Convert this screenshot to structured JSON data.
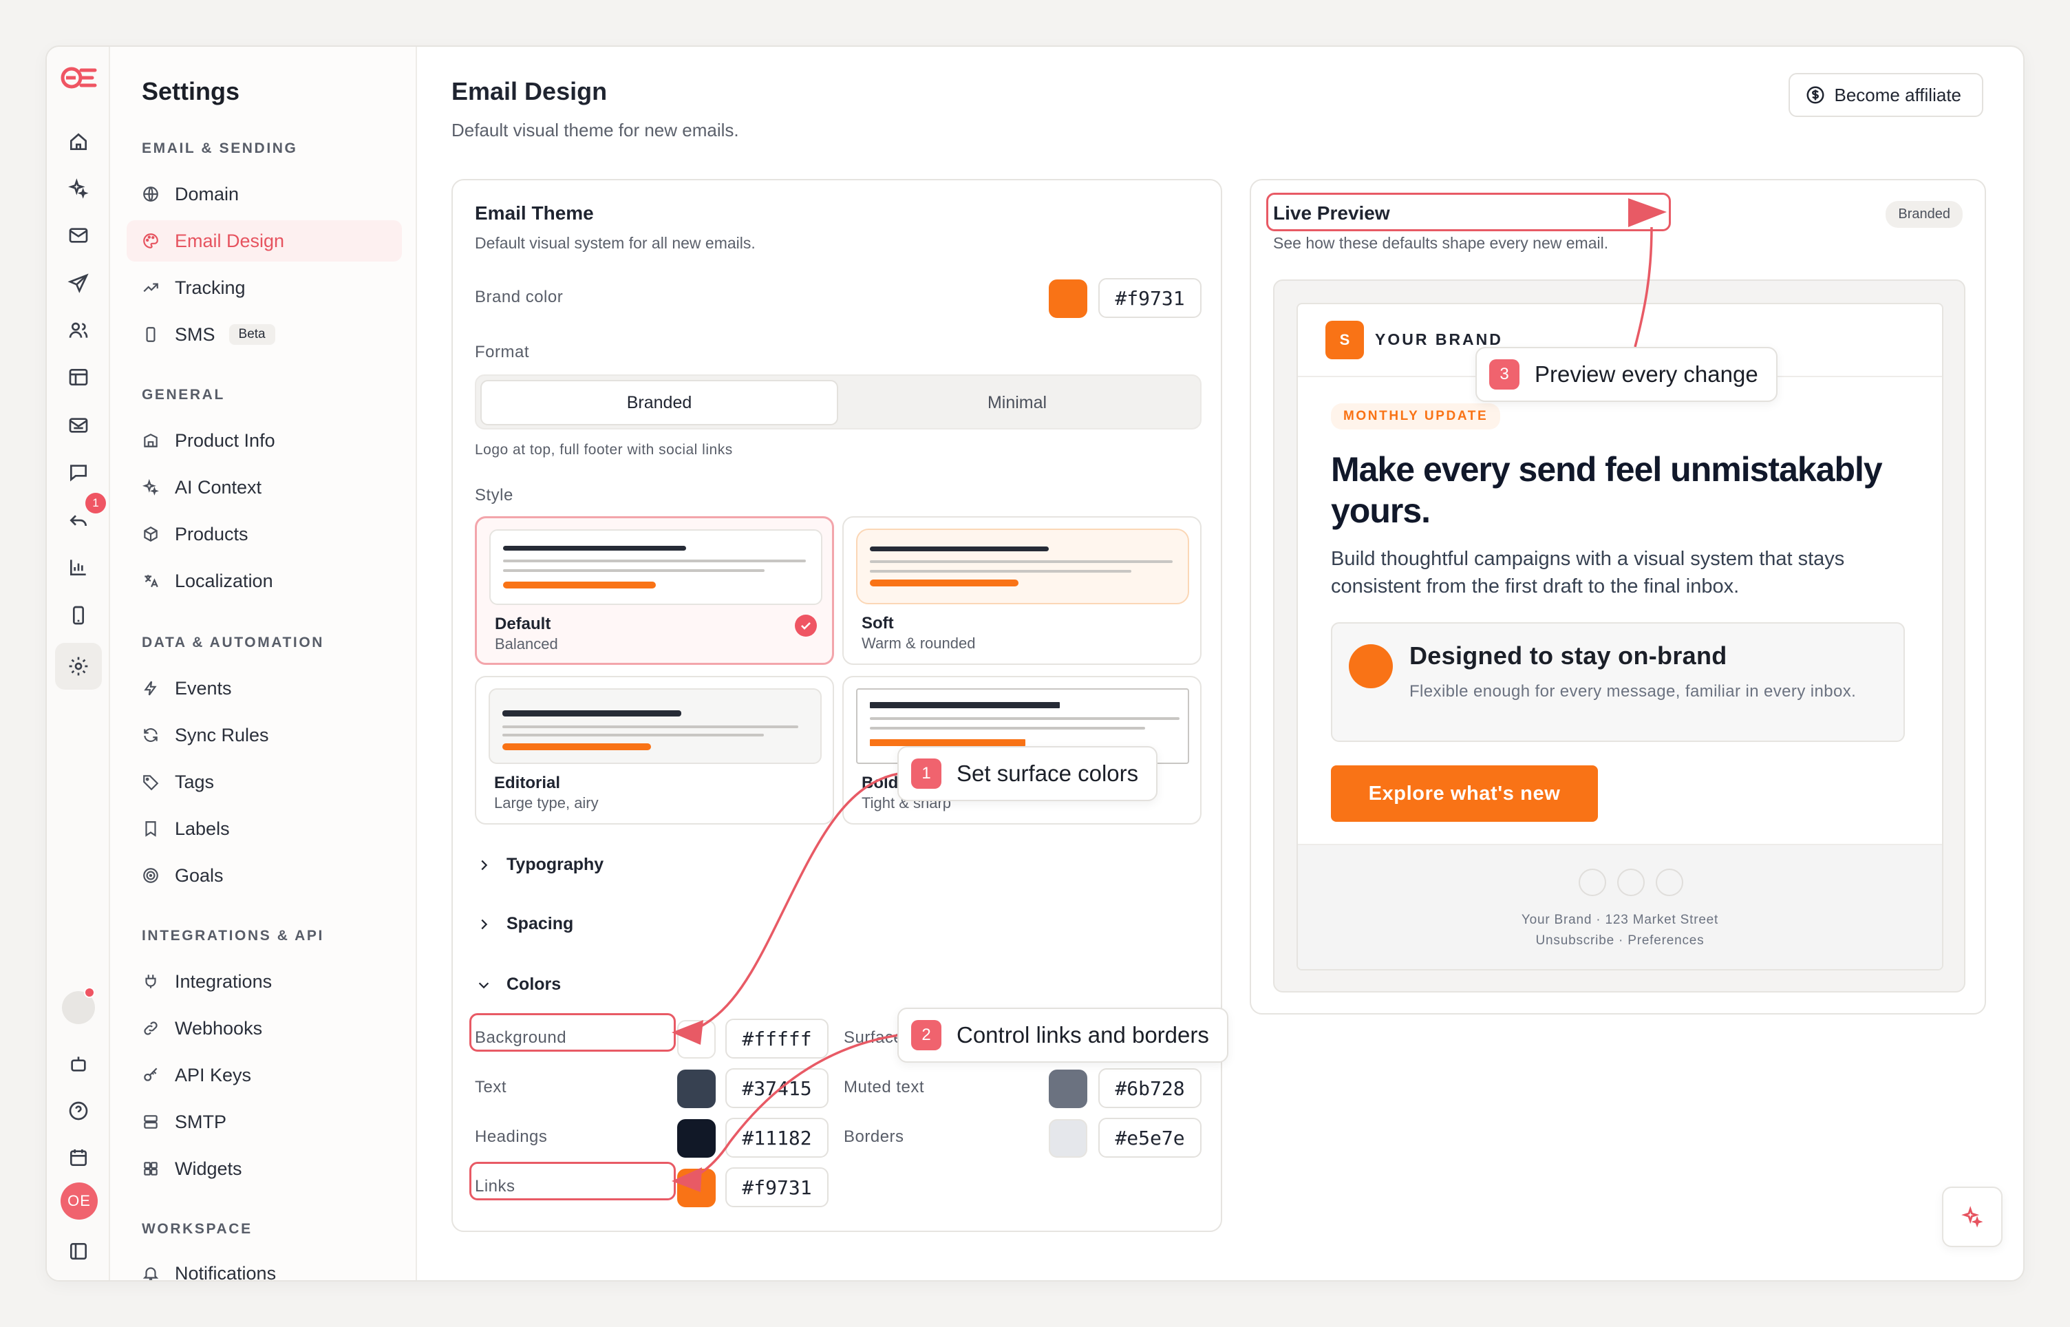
{
  "sidebar": {
    "title": "Settings",
    "notification_count": "1",
    "user_initials": "OE",
    "sections": [
      {
        "title": "EMAIL & SENDING"
      },
      {
        "title": "GENERAL"
      },
      {
        "title": "DATA & AUTOMATION"
      },
      {
        "title": "INTEGRATIONS & API"
      },
      {
        "title": "WORKSPACE"
      }
    ],
    "items": {
      "domain": "Domain",
      "email_design": "Email Design",
      "tracking": "Tracking",
      "sms": "SMS",
      "sms_badge": "Beta",
      "product_info": "Product Info",
      "ai_context": "AI Context",
      "products": "Products",
      "localization": "Localization",
      "events": "Events",
      "sync_rules": "Sync Rules",
      "tags": "Tags",
      "labels": "Labels",
      "goals": "Goals",
      "integrations": "Integrations",
      "webhooks": "Webhooks",
      "api_keys": "API Keys",
      "smtp": "SMTP",
      "widgets": "Widgets",
      "notifications": "Notifications"
    }
  },
  "header": {
    "title": "Email Design",
    "subtitle": "Default visual theme for new emails.",
    "affiliate_label": "Become affiliate"
  },
  "theme": {
    "title": "Email Theme",
    "subtitle": "Default visual system for all new emails.",
    "brand_color_label": "Brand color",
    "brand_color": "#f9731",
    "format_label": "Format",
    "format_options": [
      "Branded",
      "Minimal"
    ],
    "format_hint": "Logo at top, full footer with social links",
    "style_label": "Style",
    "styles": [
      {
        "name": "Default",
        "desc": "Balanced"
      },
      {
        "name": "Soft",
        "desc": "Warm & rounded"
      },
      {
        "name": "Editorial",
        "desc": "Large type, airy"
      },
      {
        "name": "Bold",
        "desc": "Tight & sharp"
      }
    ],
    "sections": {
      "typography": "Typography",
      "spacing": "Spacing",
      "colors": "Colors"
    },
    "colors": {
      "background": {
        "label": "Background",
        "value": "#fffff"
      },
      "surface": {
        "label": "Surface",
        "value": ""
      },
      "text": {
        "label": "Text",
        "value": "#37415"
      },
      "muted": {
        "label": "Muted text",
        "value": "#6b728"
      },
      "headings": {
        "label": "Headings",
        "value": "#11182"
      },
      "borders": {
        "label": "Borders",
        "value": "#e5e7e"
      },
      "links": {
        "label": "Links",
        "value": "#f9731"
      }
    }
  },
  "preview": {
    "title": "Live Preview",
    "subtitle": "See how these defaults shape every new email.",
    "badge": "Branded",
    "email": {
      "logo_letter": "S",
      "brand": "YOUR BRAND",
      "tag": "MONTHLY UPDATE",
      "headline": "Make every send feel unmistakably yours.",
      "body": "Build thoughtful campaigns with a visual system that stays consistent from the first draft to the final inbox.",
      "box_title": "Designed to stay on-brand",
      "box_body": "Flexible enough for every message, familiar in every inbox.",
      "cta": "Explore what's new",
      "footer_address": "Your Brand · 123 Market Street",
      "footer_links": "Unsubscribe · Preferences"
    }
  },
  "callouts": [
    {
      "num": "1",
      "text": "Set surface colors"
    },
    {
      "num": "2",
      "text": "Control links and borders"
    },
    {
      "num": "3",
      "text": "Preview every change"
    }
  ],
  "palette": {
    "accent": "#f97316",
    "highlight": "#e85a65",
    "text": "#374151",
    "muted": "#6b7280",
    "headings": "#111827",
    "borders": "#e5e7eb"
  }
}
